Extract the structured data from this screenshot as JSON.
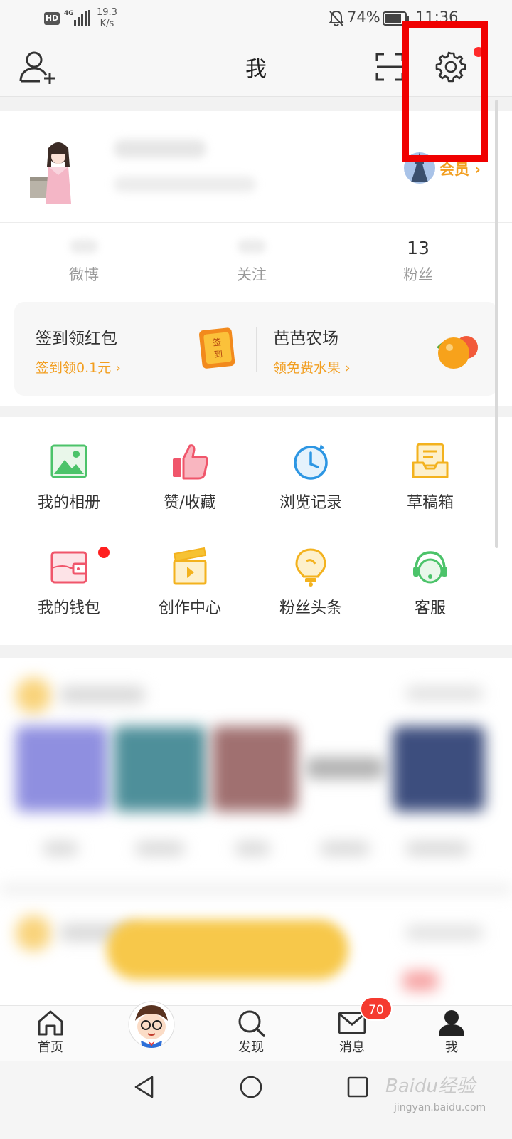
{
  "status_bar": {
    "hd": "HD",
    "network": "4G",
    "speed_value": "19.3",
    "speed_unit": "K/s",
    "battery": "74%",
    "time": "11:36"
  },
  "header": {
    "title": "我"
  },
  "profile": {
    "vip_label": "会员",
    "stats": [
      {
        "label": "微博",
        "value": ""
      },
      {
        "label": "关注",
        "value": ""
      },
      {
        "label": "粉丝",
        "value": "13"
      }
    ]
  },
  "promo": {
    "left": {
      "title": "签到领红包",
      "subtitle": "签到领0.1元"
    },
    "left_badge_text": "签到",
    "right": {
      "title": "芭芭农场",
      "subtitle": "领免费水果"
    }
  },
  "tools": [
    {
      "label": "我的相册",
      "icon": "photo-album-icon"
    },
    {
      "label": "赞/收藏",
      "icon": "thumbs-up-icon"
    },
    {
      "label": "浏览记录",
      "icon": "history-clock-icon"
    },
    {
      "label": "草稿箱",
      "icon": "drafts-tray-icon"
    },
    {
      "label": "我的钱包",
      "icon": "wallet-icon"
    },
    {
      "label": "创作中心",
      "icon": "clapperboard-icon"
    },
    {
      "label": "粉丝头条",
      "icon": "lightbulb-icon"
    },
    {
      "label": "客服",
      "icon": "headset-icon"
    }
  ],
  "tabbar": {
    "tabs": [
      {
        "label": "首页",
        "icon": "home-icon"
      },
      {
        "label": "",
        "icon": "avatar-icon"
      },
      {
        "label": "发现",
        "icon": "search-icon"
      },
      {
        "label": "消息",
        "icon": "mail-icon",
        "badge": "70"
      },
      {
        "label": "我",
        "icon": "person-icon"
      }
    ]
  },
  "watermark": {
    "text": "Baidu经验",
    "sub": "jingyan.baidu.com"
  },
  "colors": {
    "accent_orange": "#f29e1f",
    "highlight_red": "#f00000",
    "badge_red": "#f53a2f"
  }
}
